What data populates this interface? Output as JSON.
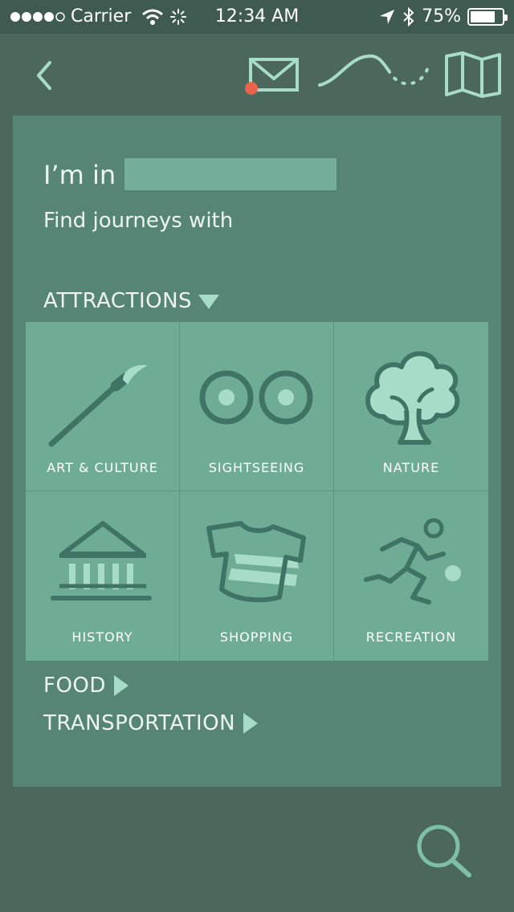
{
  "status_bar": {
    "carrier": "Carrier",
    "time": "12:34 AM",
    "battery_text": "75%",
    "battery_level": 0.75
  },
  "nav": {
    "back_icon": "chevron-left-icon",
    "mail_icon": "envelope-icon",
    "route_icon": "route-icon",
    "map_icon": "folded-map-icon",
    "notification_color": "#e8634a"
  },
  "form": {
    "im_in_label": "I’m in",
    "location_value": "",
    "find_label": "Find journeys with"
  },
  "attractions": {
    "header": "ATTRACTIONS",
    "expanded": true,
    "categories": [
      {
        "label": "ART & CULTURE",
        "icon": "paintbrush-icon"
      },
      {
        "label": "SIGHTSEEING",
        "icon": "binoculars-icon"
      },
      {
        "label": "NATURE",
        "icon": "tree-icon"
      },
      {
        "label": "HISTORY",
        "icon": "columns-building-icon"
      },
      {
        "label": "SHOPPING",
        "icon": "tshirt-icon"
      },
      {
        "label": "RECREATION",
        "icon": "runner-icon"
      }
    ]
  },
  "food": {
    "header": "FOOD"
  },
  "transportation": {
    "header": "TRANSPORTATION"
  },
  "search": {
    "icon": "search-icon"
  },
  "colors": {
    "background": "#4c675c",
    "panel": "#568576",
    "tile": "#6fac96",
    "accent": "#a6dcc8",
    "icon_dark": "#3f7464"
  }
}
